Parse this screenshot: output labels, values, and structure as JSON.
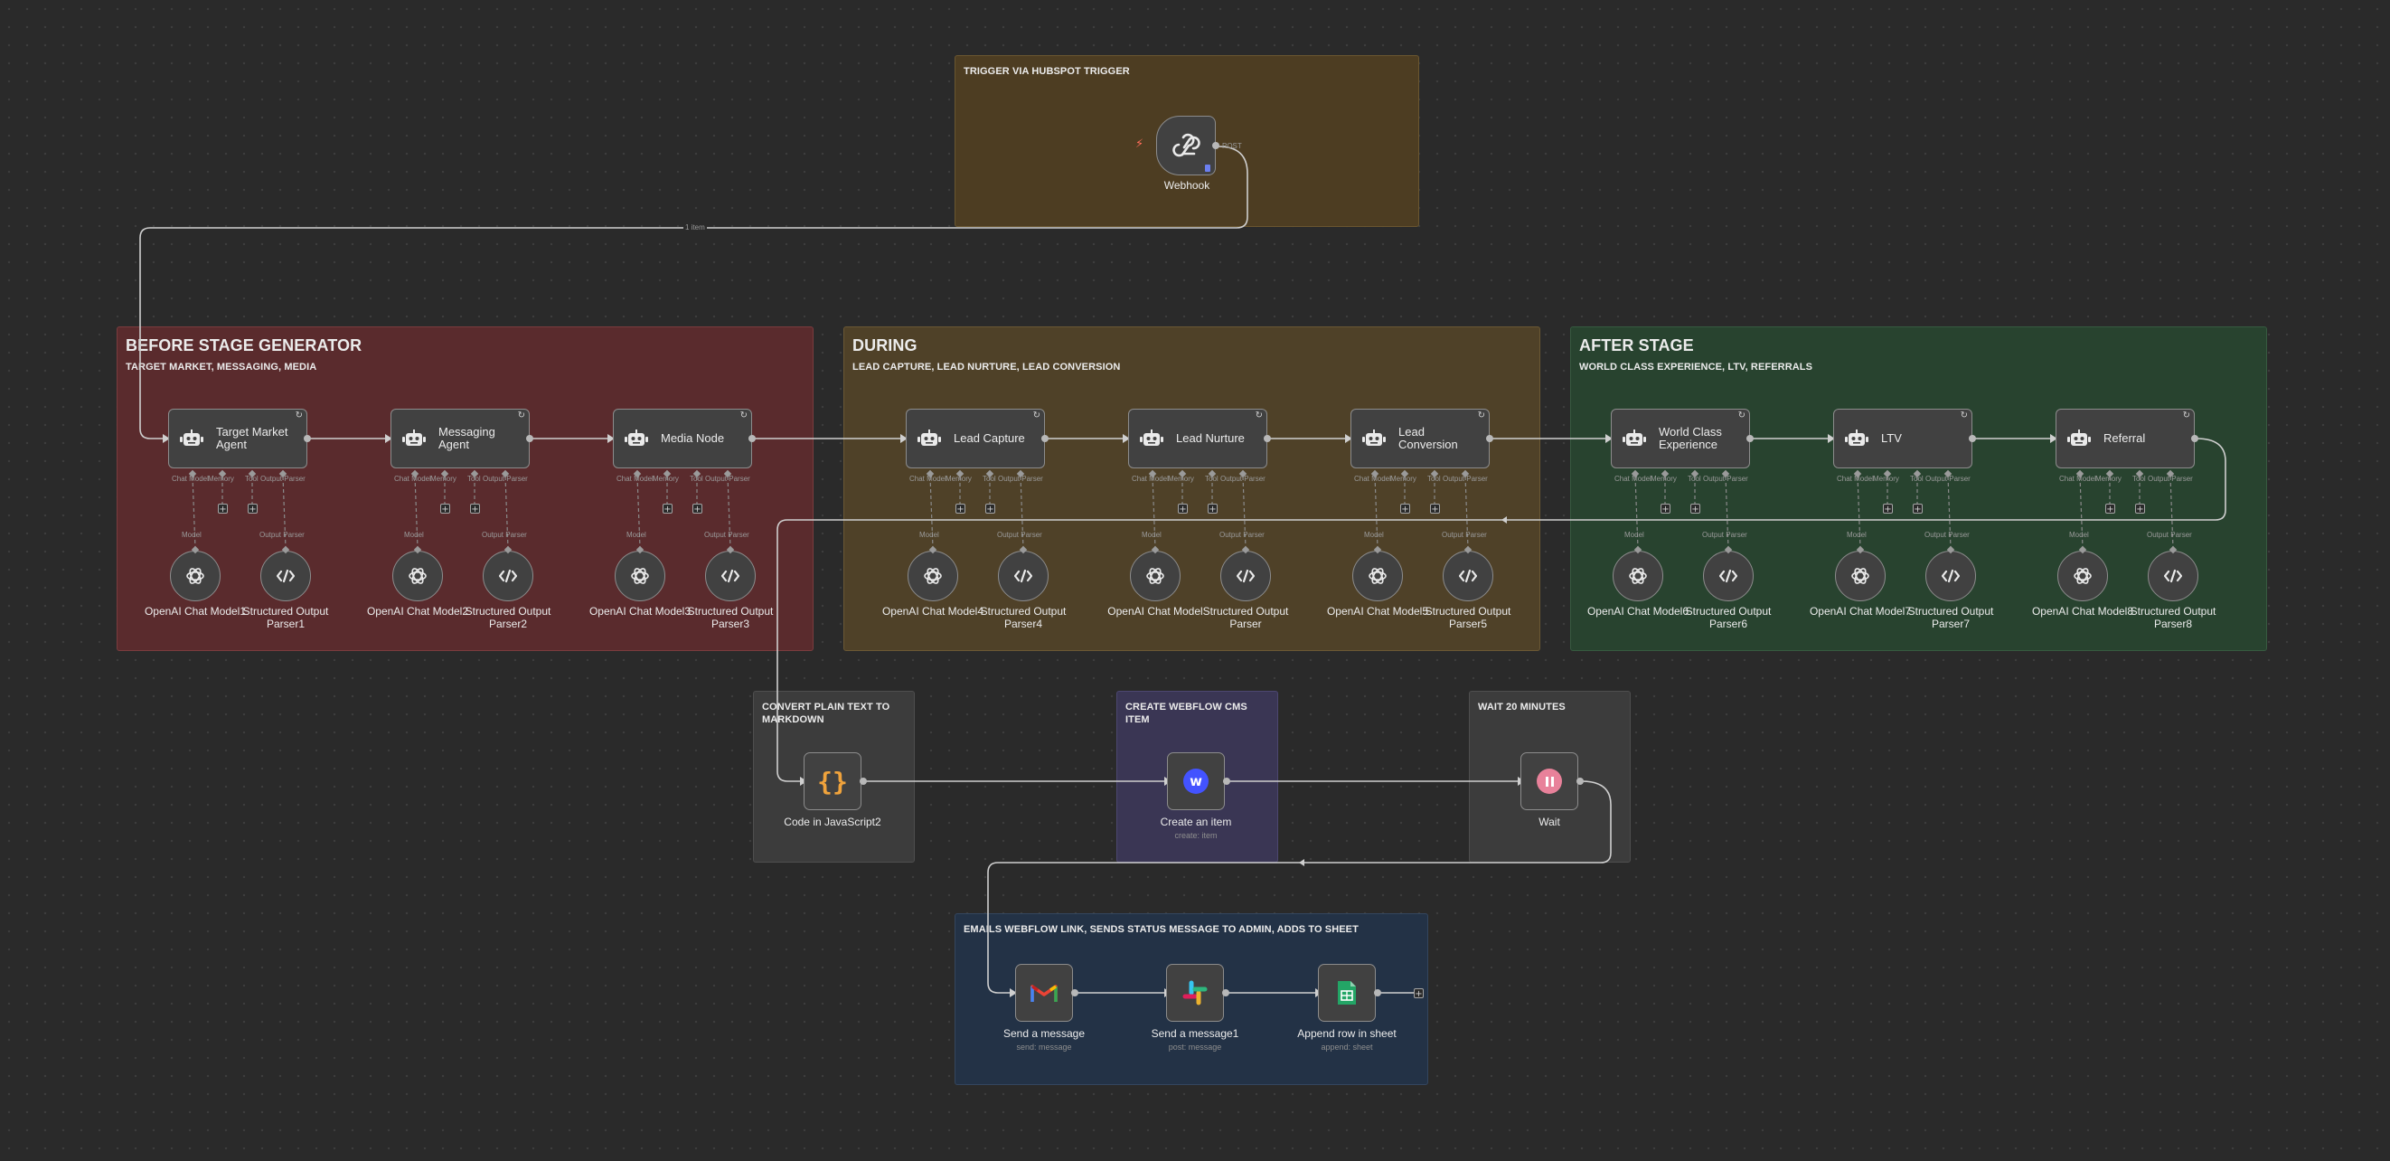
{
  "stickies": {
    "trigger": {
      "title": "TRIGGER VIA HUBSPOT TRIGGER",
      "color": "#4d3d22"
    },
    "before": {
      "title": "BEFORE STAGE GENERATOR",
      "subtitle": "TARGET MARKET, MESSAGING, MEDIA",
      "color": "#5a2b2d"
    },
    "during": {
      "title": "DURING",
      "subtitle": "LEAD CAPTURE, LEAD NURTURE, LEAD CONVERSION",
      "color": "#4f4128"
    },
    "after": {
      "title": "AFTER STAGE",
      "subtitle": "WORLD CLASS EXPERIENCE, LTV, REFERRALS",
      "color": "#28432f"
    },
    "convert": {
      "title": "CONVERT PLAIN TEXT TO MARKDOWN",
      "color": "#3c3c3c"
    },
    "webflow": {
      "title": "CREATE WEBFLOW CMS ITEM",
      "color": "#3a3654"
    },
    "wait": {
      "title": "WAIT 20 MINUTES",
      "color": "#3c3c3c"
    },
    "emails": {
      "title": "EMAILS WEBFLOW LINK, SENDS STATUS MESSAGE TO ADMIN, ADDS TO SHEET",
      "color": "#233246"
    }
  },
  "webhook": {
    "label": "Webhook",
    "method": "POST"
  },
  "connection_label": "1 item",
  "port_labels": {
    "chat_model": "Chat Model",
    "memory": "Memory",
    "tool": "Tool",
    "output_parser": "Output Parser",
    "model": "Model"
  },
  "agents": [
    {
      "label": "Target Market Agent",
      "model": "OpenAI Chat Model1",
      "parser": "Structured Output Parser1"
    },
    {
      "label": "Messaging Agent",
      "model": "OpenAI Chat Model2",
      "parser": "Structured Output Parser2"
    },
    {
      "label": "Media Node",
      "model": "OpenAI Chat Model3",
      "parser": "Structured Output Parser3"
    },
    {
      "label": "Lead Capture",
      "model": "OpenAI Chat Model4",
      "parser": "Structured Output Parser4"
    },
    {
      "label": "Lead Nurture",
      "model": "OpenAI Chat Model",
      "parser": "Structured Output Parser"
    },
    {
      "label": "Lead Conversion",
      "model": "OpenAI Chat Model5",
      "parser": "Structured Output Parser5"
    },
    {
      "label": "World Class Experience",
      "model": "OpenAI Chat Model6",
      "parser": "Structured Output Parser6"
    },
    {
      "label": "LTV",
      "model": "OpenAI Chat Model7",
      "parser": "Structured Output Parser7"
    },
    {
      "label": "Referral",
      "model": "OpenAI Chat Model8",
      "parser": "Structured Output Parser8"
    }
  ],
  "bottom_nodes": {
    "code": {
      "label": "Code in JavaScript2",
      "icon": "code-braces-icon"
    },
    "webflow": {
      "label": "Create an item",
      "sub": "create: item",
      "icon": "webflow-icon"
    },
    "wait": {
      "label": "Wait",
      "icon": "pause-icon"
    },
    "gmail": {
      "label": "Send a message",
      "sub": "send: message",
      "icon": "gmail-icon"
    },
    "slack": {
      "label": "Send a message1",
      "sub": "post: message",
      "icon": "slack-icon"
    },
    "sheets": {
      "label": "Append row in sheet",
      "sub": "append: sheet",
      "icon": "google-sheets-icon"
    }
  },
  "colors": {
    "wire": "#cfcfcf",
    "port": "#b8b8b8",
    "node_bg": "#414141",
    "node_border": "#8c8c8c",
    "webflow": "#4353ff",
    "wait": "#e8819a",
    "code": "#f0a33c"
  }
}
